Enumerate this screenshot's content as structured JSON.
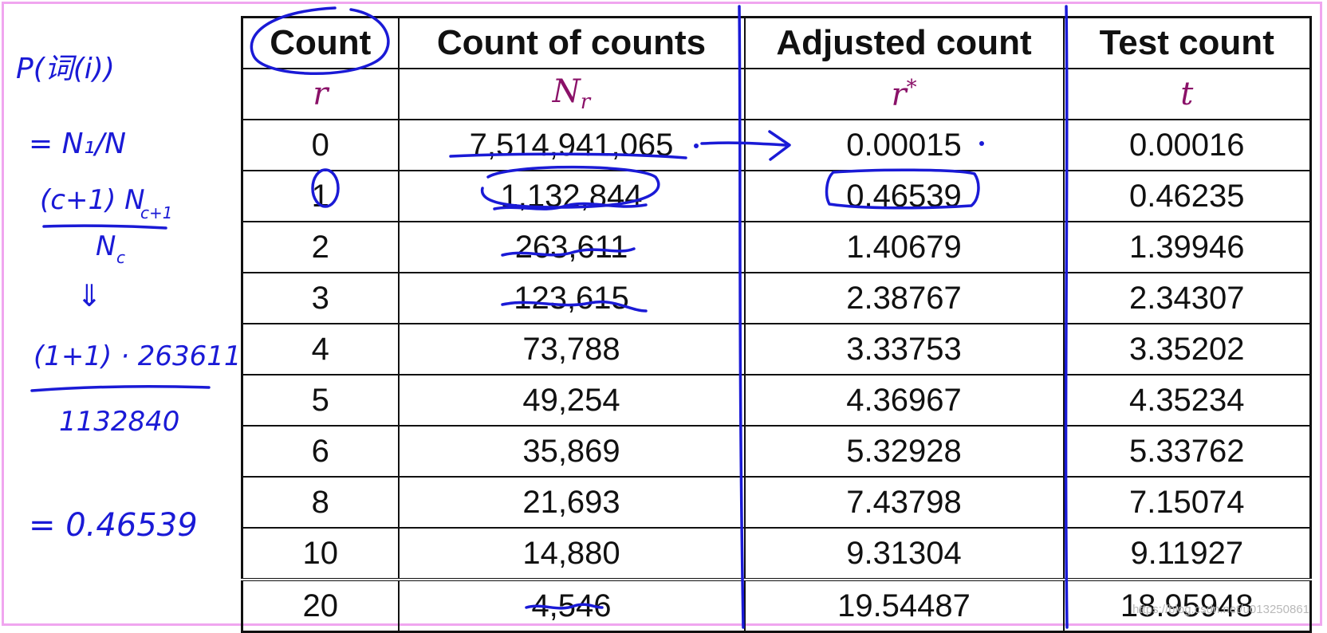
{
  "table": {
    "headers": [
      "Count",
      "Count of counts",
      "Adjusted count",
      "Test count"
    ],
    "symbols": {
      "count": "r",
      "nr_base": "N",
      "nr_sub": "r",
      "adj_base": "r",
      "adj_sup": "*",
      "test": "t"
    },
    "rows": [
      {
        "r": "0",
        "nr": "7,514,941,065",
        "adj": "0.00015",
        "test": "0.00016"
      },
      {
        "r": "1",
        "nr": "1,132,844",
        "adj": "0.46539",
        "test": "0.46235"
      },
      {
        "r": "2",
        "nr": "263,611",
        "adj": "1.40679",
        "test": "1.39946"
      },
      {
        "r": "3",
        "nr": "123,615",
        "adj": "2.38767",
        "test": "2.34307"
      },
      {
        "r": "4",
        "nr": "73,788",
        "adj": "3.33753",
        "test": "3.35202"
      },
      {
        "r": "5",
        "nr": "49,254",
        "adj": "4.36967",
        "test": "4.35234"
      },
      {
        "r": "6",
        "nr": "35,869",
        "adj": "5.32928",
        "test": "5.33762"
      },
      {
        "r": "8",
        "nr": "21,693",
        "adj": "7.43798",
        "test": "7.15074"
      },
      {
        "r": "10",
        "nr": "14,880",
        "adj": "9.31304",
        "test": "9.11927"
      },
      {
        "r": "20",
        "nr": "4,546",
        "adj": "19.54487",
        "test": "18.95948"
      }
    ]
  },
  "annotations": {
    "line1": "P(词(i))",
    "line2": "= N₁/N",
    "line3_num": "(c+1) N",
    "line3_sub": "c+1",
    "line3_den": "N",
    "line3_den_sub": "c",
    "line4": "⇓",
    "line5_num": "(1+1) · 263611",
    "line5_den": "1132840",
    "line6": "= 0.46539"
  },
  "watermark": "https://blog.csdn.net/u013250861",
  "colors": {
    "ink": "#1a1ad6",
    "symbol": "#8a1168",
    "frame": "#f0a6ef"
  }
}
